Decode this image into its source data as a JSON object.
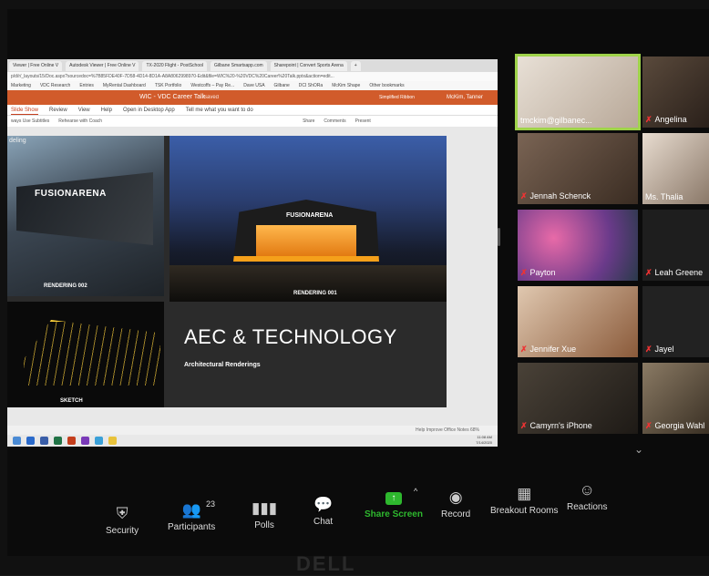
{
  "browser": {
    "tabs": [
      "Viewer | Free Online V",
      "Autodesk Viewer | Free Online V",
      "TX-2020 Flight - PostSchool",
      "Gilbane Smartsapp.com",
      "Sharepoint | Convert Sports Arena",
      "+"
    ],
    "address": "p/d/r/_layouts/15/Doc.aspx?sourcedoc=%7B85FDE40F-7D58-4D14-8D1A-A8A8062998970-Edit&file=WIC%20-%20VDC%20Career%20Talk.pptx&action=edit...",
    "bookmarks": [
      "Marketing",
      "VDC Research",
      "Entries",
      "MyRental Dashboard",
      "TSK Portfolio",
      "Westcoffs – Pay Re...",
      "Dave USA",
      "Gilbane",
      "DCI ShORa",
      "McKim Shape",
      "Other bookmarks"
    ]
  },
  "powerpoint": {
    "title": "WIC - VDC Career Talk",
    "saved": "Saved",
    "simplified_ribbon": "Simplified Ribbon",
    "user": "McKim, Tanner",
    "ribbon_tabs": [
      "Slide Show",
      "Review",
      "View",
      "Help",
      "Open in Desktop App",
      "Tell me what you want to do"
    ],
    "ribbon2": [
      "ways Use Subtitles",
      "Rehearse with Coach",
      "Share",
      "Comments",
      "Present"
    ],
    "status": "Help Improve Office   Notes   68%",
    "clock_time": "11:08 AM",
    "clock_date": "7/14/2020"
  },
  "slide": {
    "corner_label": "deling",
    "logo_002": "FUSIONARENA",
    "caption_002": "RENDERING 002",
    "logo_001": "FUSIONARENA",
    "caption_001": "RENDERING 001",
    "caption_sketch": "SKETCH",
    "heading": "AEC & TECHNOLOGY",
    "subheading": "Architectural Renderings"
  },
  "participants": [
    {
      "name": "tmckim@gilbanec...",
      "muted": false,
      "color": "#d9cfc2",
      "active": true
    },
    {
      "name": "Angelina",
      "muted": true,
      "color": "#4a3a30"
    },
    {
      "name": "Jennah Schenck",
      "muted": true,
      "color": "#5a4a3e"
    },
    {
      "name": "Ms. Thalia",
      "muted": false,
      "color": "#c9b8a6"
    },
    {
      "name": "Payton",
      "muted": true,
      "color": "#7a4a6a"
    },
    {
      "name": "Leah Greene",
      "muted": true,
      "color": "#2a2a2a"
    },
    {
      "name": "Jennifer Xue",
      "muted": true,
      "color": "#a8785a"
    },
    {
      "name": "Jayel",
      "muted": true,
      "color": "#2c2c2c"
    },
    {
      "name": "Camyrn's iPhone",
      "muted": true,
      "color": "#3a3530"
    },
    {
      "name": "Georgia Wahl",
      "muted": true,
      "color": "#6b5a48"
    }
  ],
  "toolbar": {
    "security": "Security",
    "participants": "Participants",
    "participants_count": "23",
    "polls": "Polls",
    "chat": "Chat",
    "share_screen": "Share Screen",
    "record": "Record",
    "breakout": "Breakout Rooms",
    "reactions": "Reactions"
  },
  "brand": "DELL"
}
